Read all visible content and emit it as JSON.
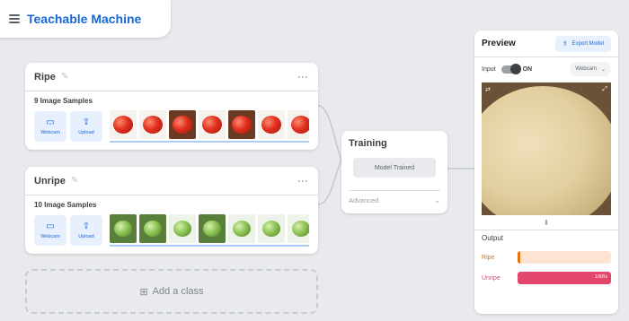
{
  "app": {
    "title": "Teachable Machine"
  },
  "classes": [
    {
      "name": "Ripe",
      "samples_label": "9 Image Samples",
      "webcam_label": "Webcam",
      "upload_label": "Upload"
    },
    {
      "name": "Unripe",
      "samples_label": "10 Image Samples",
      "webcam_label": "Webcam",
      "upload_label": "Upload"
    }
  ],
  "add_class": {
    "label": "Add a class"
  },
  "training": {
    "title": "Training",
    "button_label": "Model Trained",
    "advanced_label": "Advanced"
  },
  "preview": {
    "title": "Preview",
    "export_label": "Export Model",
    "input_label": "Input",
    "input_state": "ON",
    "source_select": "Webcam",
    "output_title": "Output",
    "outputs": [
      {
        "label": "Ripe",
        "fraction": 0.03,
        "color": "#e8710a",
        "track": "#fde4d2",
        "pct_text": ""
      },
      {
        "label": "Unripe",
        "fraction": 1.0,
        "color": "#e2466b",
        "track": "#f9dae1",
        "pct_text": "100%"
      }
    ]
  },
  "colors": {
    "accent": "#1967d2",
    "ripe": "#e8710a",
    "unripe": "#e2466b"
  }
}
